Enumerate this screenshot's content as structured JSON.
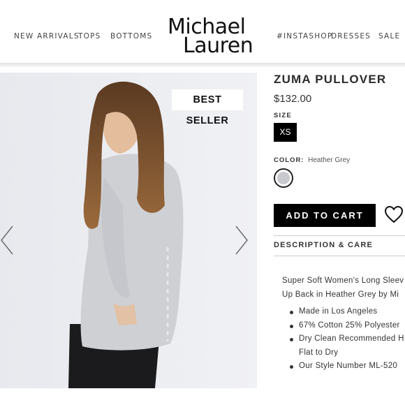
{
  "nav": {
    "left": [
      "NEW ARRIVALS",
      "TOPS",
      "BOTTOMS"
    ],
    "right": [
      "#INSTASHOP",
      "DRESSES",
      "SALE"
    ]
  },
  "logo": {
    "line1": "Michael",
    "line2": "Lauren"
  },
  "badge": "BEST SELLER",
  "product": {
    "name": "ZUMA PULLOVER",
    "price": "$132.00",
    "size_label": "SIZE",
    "size_selected": "XS",
    "color_label": "COLOR:",
    "color_value": "Heather Grey",
    "swatch_color": "#c8c9ce"
  },
  "add_to_cart": "ADD TO CART",
  "description_heading": "DESCRIPTION & CARE",
  "description": {
    "line1": "Super Soft Women's Long Sleev",
    "line2": "Up Back in Heather Grey by Mi"
  },
  "bullets": [
    "Made in Los Angeles",
    "67% Cotton 25% Polyester",
    "Dry Clean Recommended H",
    "Flat to Dry",
    "Our Style Number ML-520"
  ],
  "icons": {
    "prev": "chevron-left-icon",
    "next": "chevron-right-icon",
    "wishlist": "heart-icon"
  }
}
